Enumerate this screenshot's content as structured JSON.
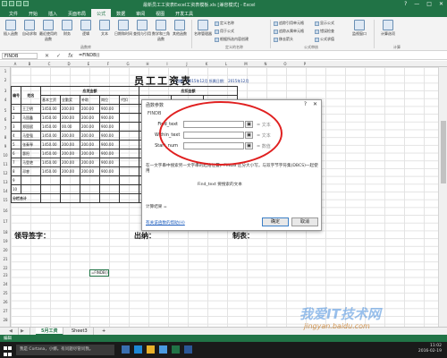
{
  "window": {
    "title": "最新员工工资表Excel工资表模板.xls  [兼容模式] - Excel",
    "controls": [
      "?",
      "—",
      "□",
      "✕"
    ]
  },
  "ribbon": {
    "tabs": [
      "文件",
      "开始",
      "插入",
      "页面布局",
      "公式",
      "数据",
      "审阅",
      "视图",
      "开发工具"
    ],
    "active_tab": "公式",
    "buttons": {
      "insert_function": "插入函数",
      "autosum": "自动求和",
      "recent": "最近使用的函数",
      "financial": "财务",
      "logical": "逻辑",
      "text": "文本",
      "datetime": "日期和时间",
      "lookup": "查找与引用",
      "math": "数学和三角函数",
      "other": "其他函数",
      "name_manager": "名称管理器",
      "define_name": "定义名称",
      "use_in_formula": "用于公式",
      "create_from_selection": "根据所选内容创建",
      "trace_precedents": "追踪引用单元格",
      "trace_dependents": "追踪从属单元格",
      "remove_arrows": "移去箭头",
      "show_formulas": "显示公式",
      "error_checking": "错误检查",
      "evaluate_formula": "公式求值",
      "watch_window": "监视窗口",
      "calc_options": "计算选项"
    },
    "group_labels": {
      "function_library": "函数库",
      "defined_names": "定义的名称",
      "formula_auditing": "公式审核",
      "calculation": "计算"
    }
  },
  "formula_bar": {
    "name_box": "FINDB",
    "cancel": "✕",
    "enter": "✓",
    "fx": "fx",
    "formula": "=FINDB()"
  },
  "grid": {
    "columns": [
      "A",
      "B",
      "C",
      "D",
      "E",
      "F",
      "G",
      "H",
      "I",
      "J",
      "K",
      "L",
      "M",
      "N",
      "O",
      "P"
    ],
    "rows": [
      "1",
      "2",
      "3",
      "4",
      "5",
      "6",
      "7",
      "8",
      "9",
      "10",
      "11",
      "12",
      "13",
      "14",
      "15",
      "16",
      "17",
      "18",
      "19",
      "20",
      "21",
      "22",
      "23",
      "24",
      "25",
      "26",
      "27",
      "28"
    ],
    "active_cell_text": "=FINDB()"
  },
  "paysheet": {
    "title": "员工工资表",
    "date_line": "日期： 2015年12月  所属日期： 2015年12月",
    "col_number": "编号",
    "col_name": "姓名",
    "group_payable": "应发金额",
    "group_deduct": "应扣金额",
    "sub_headers": [
      "基本工资",
      "全勤奖",
      "补助",
      "岗位",
      "代扣"
    ],
    "rows": [
      {
        "no": "1",
        "name": "王卫明",
        "v": [
          "1450.00",
          "200.00",
          "200.00",
          "900.00"
        ]
      },
      {
        "no": "2",
        "name": "马国鑫",
        "v": [
          "1450.00",
          "200.00",
          "200.00",
          "900.00"
        ]
      },
      {
        "no": "3",
        "name": "郑国斌",
        "v": [
          "1450.00",
          "00.00",
          "200.00",
          "900.00"
        ]
      },
      {
        "no": "4",
        "name": "马登强",
        "v": [
          "1450.00",
          "200.00",
          "200.00",
          "900.00"
        ]
      },
      {
        "no": "5",
        "name": "张秦琴",
        "v": [
          "1450.00",
          "200.00",
          "200.00",
          "900.00"
        ]
      },
      {
        "no": "6",
        "name": "惠阳",
        "v": [
          "1450.00",
          "200.00",
          "200.00",
          "900.00"
        ]
      },
      {
        "no": "7",
        "name": "马登艳",
        "v": [
          "1450.00",
          "200.00",
          "200.00",
          "900.00"
        ]
      },
      {
        "no": "8",
        "name": "邓睿",
        "v": [
          "1450.00",
          "200.00",
          "200.00",
          "900.00"
        ]
      },
      {
        "no": "9",
        "name": "",
        "v": [
          "",
          "",
          "",
          ""
        ]
      },
      {
        "no": "10",
        "name": "",
        "v": [
          "",
          "",
          "",
          ""
        ]
      }
    ],
    "subtotal_label": "分栏合计",
    "sign_leader": "领导签字：",
    "sign_cashier": "出纳：",
    "sign_maker": "制表："
  },
  "dialog": {
    "title": "函数参数",
    "help": "?",
    "close": "✕",
    "function_name": "FINDB",
    "args": [
      {
        "label": "Find_text",
        "result": "= 文本"
      },
      {
        "label": "Within_text",
        "result": "= 文本"
      },
      {
        "label": "Start_num",
        "result": "= 数值"
      }
    ],
    "description": "在一文字串中搜索另一文字串的起始位置。FINDB 区分大小写。与双字节字符集(DBCS)一起使用",
    "arg_description": "Find_text  要搜索的文本",
    "result_label": "计算结果 =",
    "help_link": "有关该函数的帮助(H)",
    "ok": "确定",
    "cancel": "取消"
  },
  "sheets": {
    "tabs": [
      "5月工资",
      "Sheet3"
    ],
    "active": "5月工资",
    "add": "+"
  },
  "status": {
    "mode": "编辑"
  },
  "taskbar": {
    "search_placeholder": "我是 Cortana，小娜。有问题尽管问我。",
    "time": "11:02",
    "date": "2016-02-19"
  },
  "watermark": {
    "main": "我爱IT技术网",
    "sub": "jingyan.baidu.com"
  },
  "colors": {
    "excel_green": "#217346",
    "oval_red": "#e02020",
    "link_blue": "#1f5fbf"
  }
}
